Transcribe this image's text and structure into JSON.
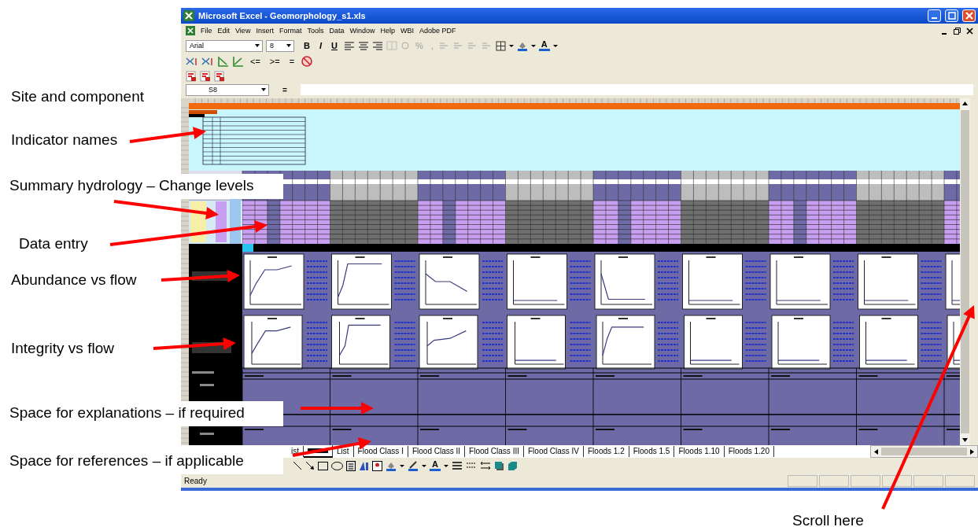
{
  "window": {
    "title": "Microsoft Excel - Geomorphology_s1.xls"
  },
  "menu": [
    "File",
    "Edit",
    "View",
    "Insert",
    "Format",
    "Tools",
    "Data",
    "Window",
    "Help",
    "WBI",
    "Adobe PDF"
  ],
  "format_toolbar": {
    "font": "Arial",
    "size": "8",
    "buttons": [
      {
        "label": "B",
        "kind": "bold"
      },
      {
        "label": "I",
        "kind": "italic"
      },
      {
        "label": "U",
        "kind": "underline"
      }
    ],
    "number_buttons": [
      "%",
      ","
    ],
    "font_color": "A"
  },
  "compare_toolbar": {
    "buttons": [
      "<=",
      ">=",
      "="
    ]
  },
  "formula_bar": {
    "name_box": "S8",
    "equals": "="
  },
  "sheet_tabs": [
    {
      "label": "ist",
      "selected": false
    },
    {
      "selected": true
    },
    {
      "label": "List",
      "selected": false
    },
    {
      "label": "Flood Class I",
      "selected": false
    },
    {
      "label": "Flood Class II",
      "selected": false
    },
    {
      "label": "Flood Class III",
      "selected": false
    },
    {
      "label": "Flood Class IV",
      "selected": false
    },
    {
      "label": "Floods 1.2",
      "selected": false
    },
    {
      "label": "Floods 1.5",
      "selected": false
    },
    {
      "label": "Floods 1.10",
      "selected": false
    },
    {
      "label": "Floods 1.20",
      "selected": false
    }
  ],
  "drawing_toolbar": {
    "font_color": "A"
  },
  "status_bar": {
    "text": "Ready"
  },
  "annotations": [
    {
      "text": "Site and component"
    },
    {
      "text": "Indicator names"
    },
    {
      "text": "Summary hydrology – Change levels"
    },
    {
      "text": "Data entry"
    },
    {
      "text": "Abundance vs flow"
    },
    {
      "text": "Integrity vs flow"
    },
    {
      "text": "Space for explanations – if required"
    },
    {
      "text": "Space for references – if applicable"
    },
    {
      "text": "Scroll here"
    }
  ]
}
